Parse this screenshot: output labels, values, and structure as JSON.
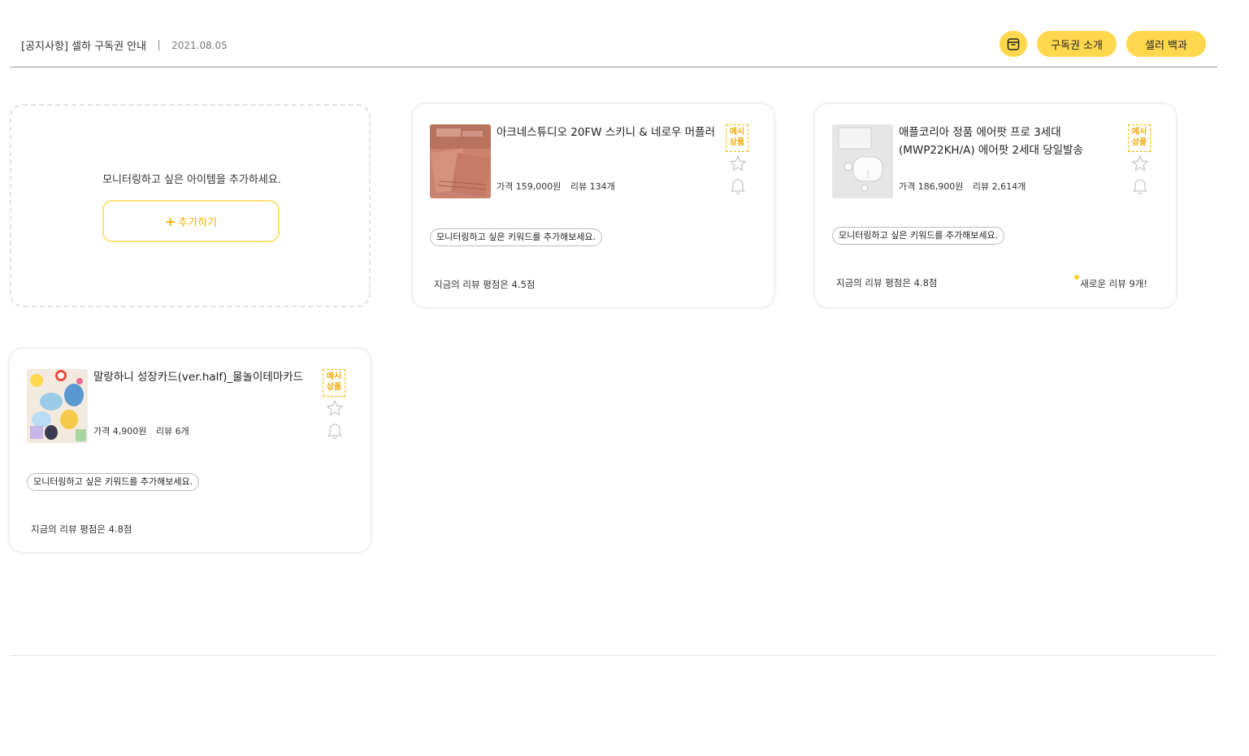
{
  "notice": {
    "title": "[공지사항] 셀하 구독권 안내",
    "date": "2021.08.05"
  },
  "header": {
    "icon": "inbox-box-icon",
    "subscription_intro_label": "구독권 소개",
    "seller_wiki_label": "셀러 백과"
  },
  "add_card": {
    "message": "모니터링하고 싶은 아이템을 추가하세요.",
    "button_label": "추가하기"
  },
  "products": [
    {
      "title": "아크네스튜디오 20FW 스키니 & 네로우 머플러",
      "price": "가격 159,000원",
      "reviews": "리뷰 134개",
      "badge": "예시 상품",
      "keyword_prompt": "모니터링하고 싶은 키워드를 추가해보세요.",
      "rating": "지금의 리뷰 평점은 4.5점",
      "new_reviews": ""
    },
    {
      "title": "애플코리아 정품 에어팟 프로 3세대 (MWP22KH/A) 에어팟 2세대 당일발송",
      "price": "가격 186,900원",
      "reviews": "리뷰 2,614개",
      "badge": "예시 상품",
      "keyword_prompt": "모니터링하고 싶은 키워드를 추가해보세요.",
      "rating": "지금의 리뷰 평점은 4.8점",
      "new_reviews": "새로운 리뷰 9개!"
    },
    {
      "title": "말랑하니 성장카드(ver.half)_물놀이테마카드",
      "price": "가격 4,900원",
      "reviews": "리뷰 6개",
      "badge": "예시 상품",
      "keyword_prompt": "모니터링하고 싶은 키워드를 추가해보세요.",
      "rating": "지금의 리뷰 평점은 4.8점",
      "new_reviews": ""
    }
  ],
  "colors": {
    "accent": "#ffd84d",
    "badge": "#f0a800",
    "new_dot": "#ffcf26"
  }
}
